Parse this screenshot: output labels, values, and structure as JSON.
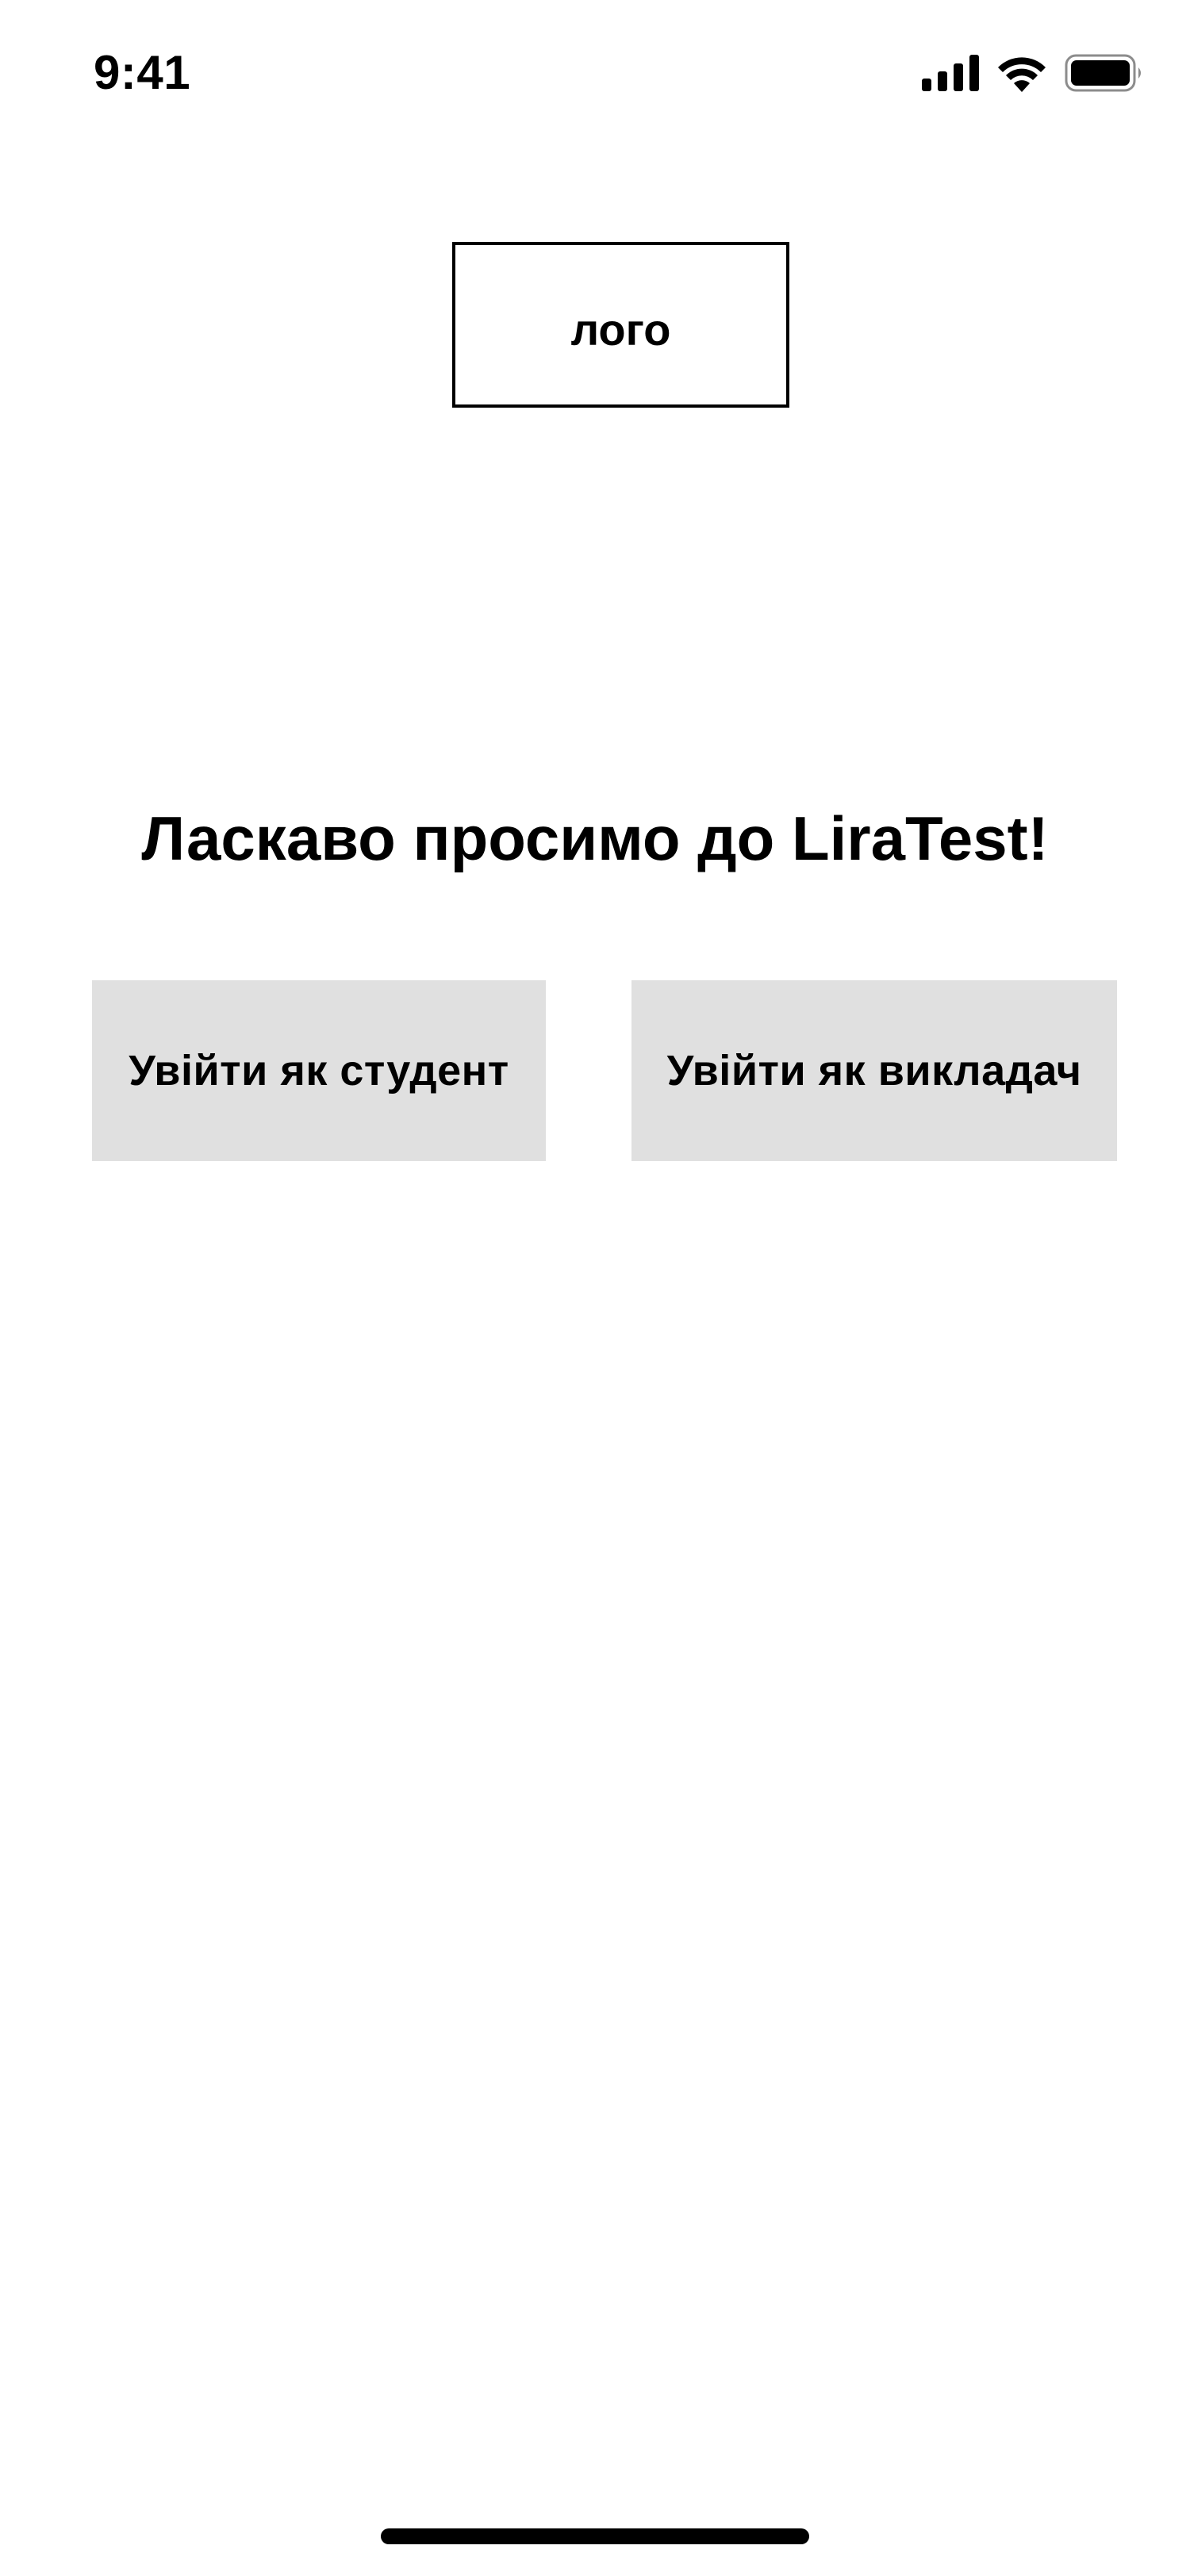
{
  "status_bar": {
    "time": "9:41",
    "icons": [
      "cellular-signal-icon",
      "wifi-icon",
      "battery-icon"
    ]
  },
  "logo": {
    "label": "лого"
  },
  "welcome": {
    "title": "Ласкаво просимо до LiraTest!"
  },
  "buttons": {
    "student_label": "Увійти як студент",
    "teacher_label": "Увійти як викладач"
  },
  "colors": {
    "background": "#ffffff",
    "button_fill": "#e0e0e0",
    "text": "#000000"
  }
}
